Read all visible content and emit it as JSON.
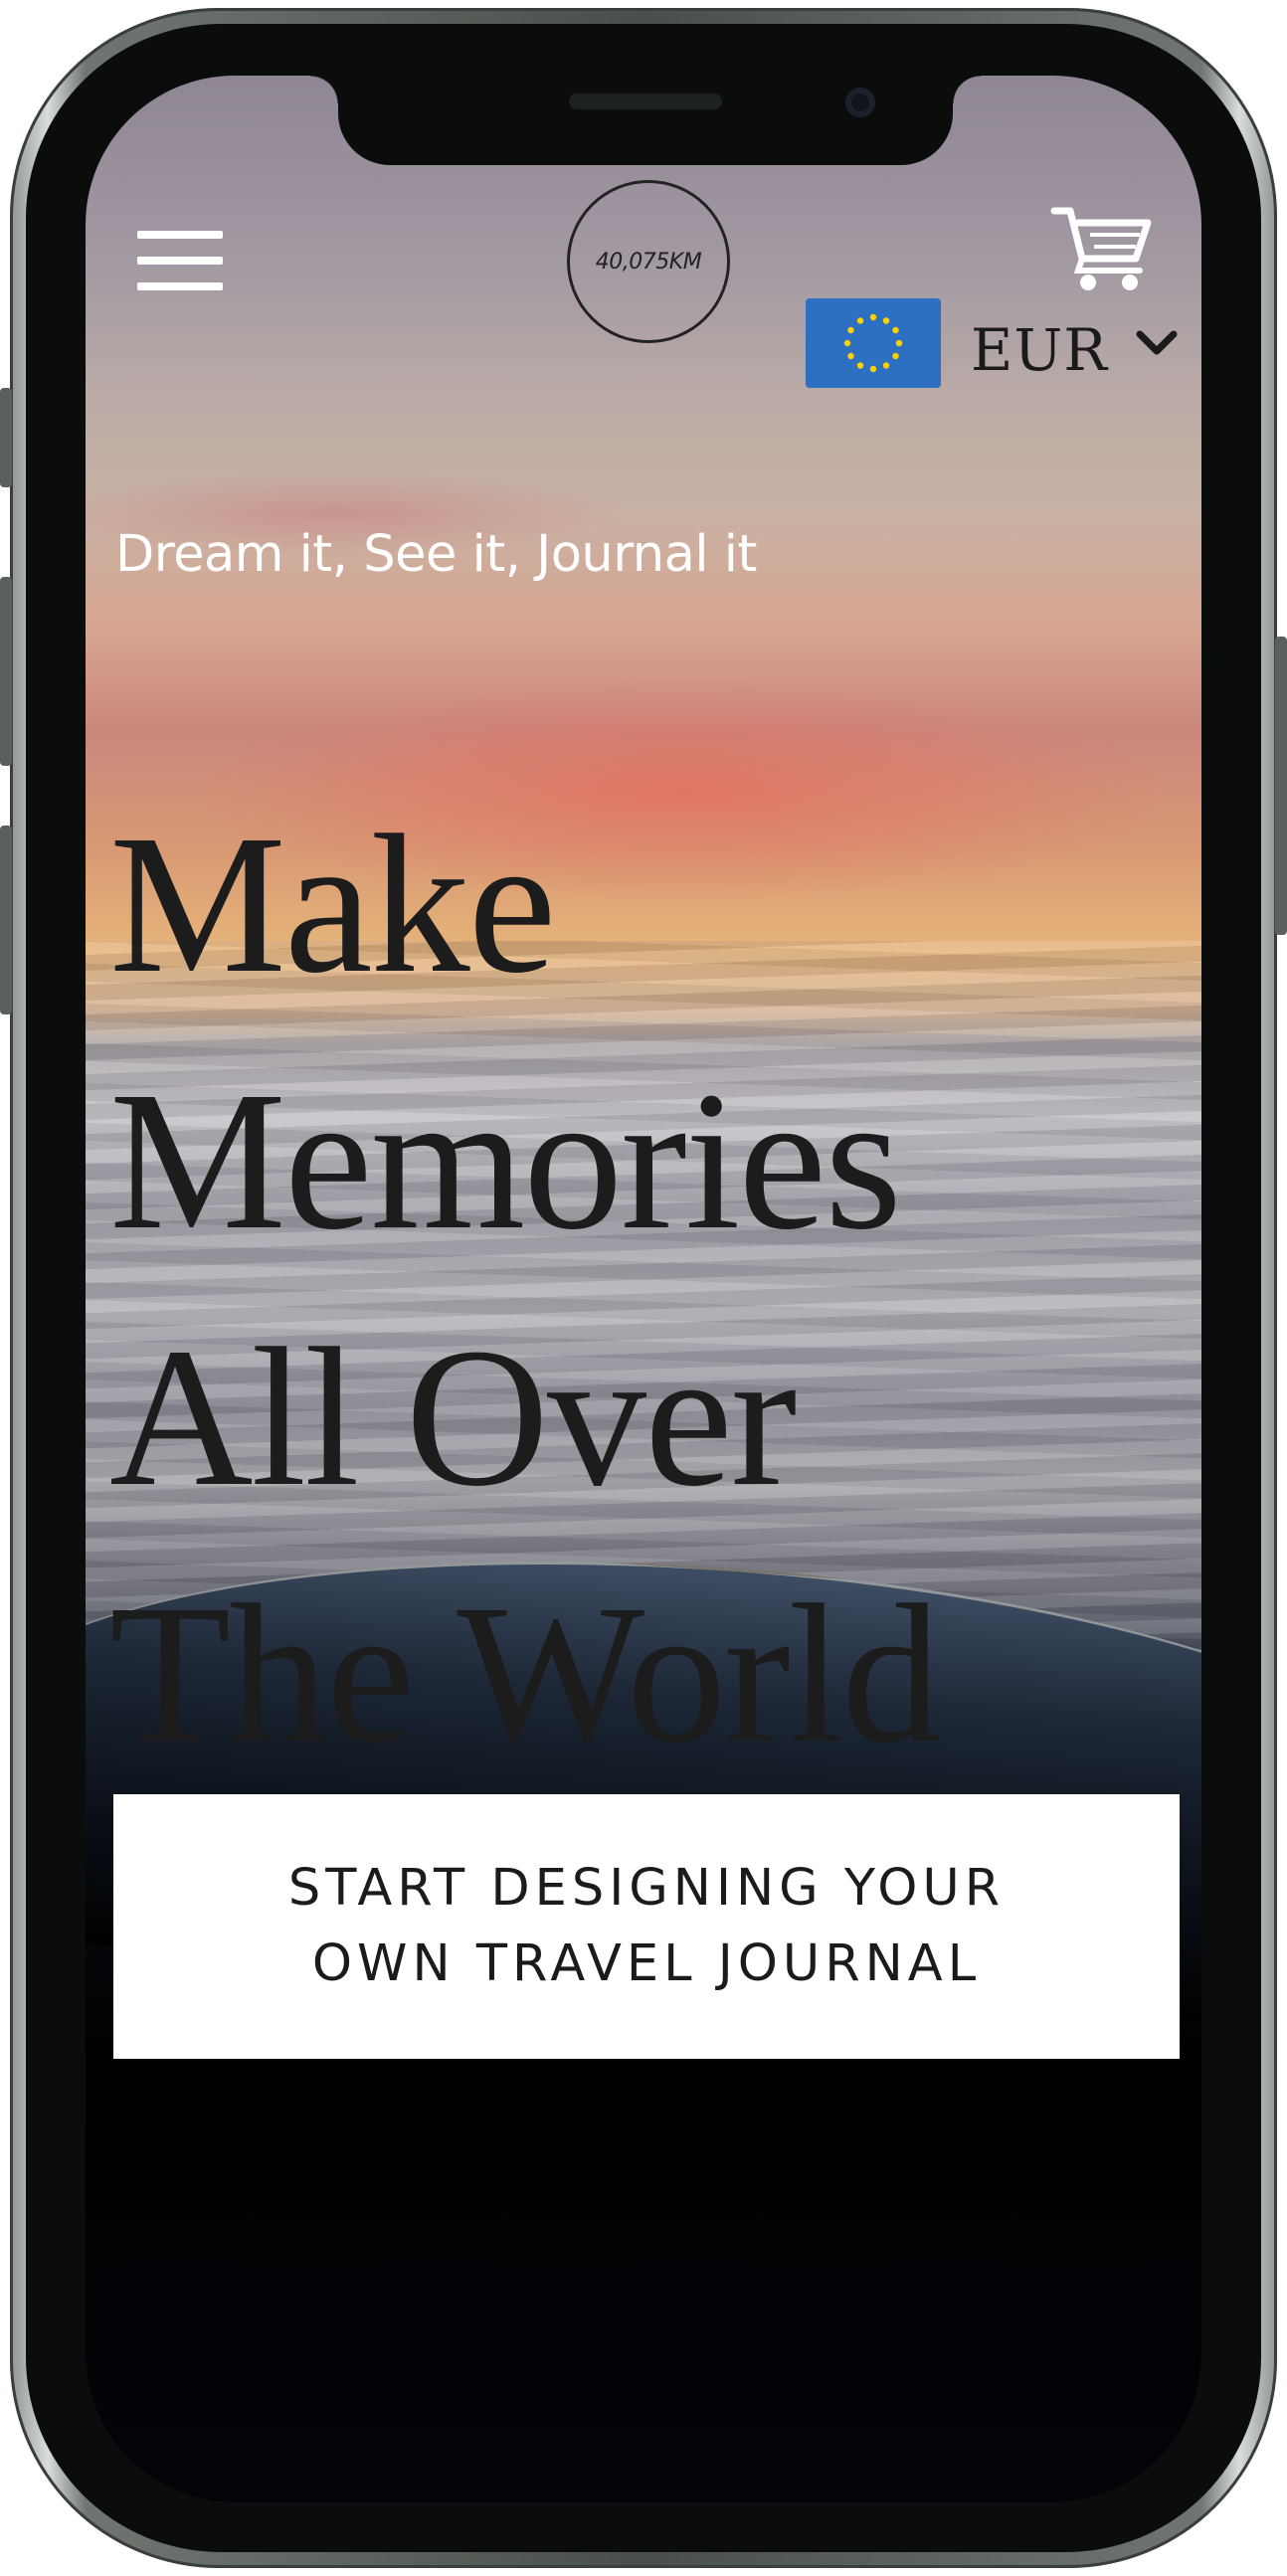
{
  "header": {
    "logo_text": "40,075KM",
    "menu_icon": "hamburger-icon",
    "cart_icon": "shopping-cart-icon",
    "currency": {
      "code": "EUR",
      "flag_icon": "eu-flag-icon",
      "dropdown_icon": "chevron-down-icon"
    }
  },
  "hero": {
    "tagline": "Dream it, See it, Journal it",
    "headline_lines": [
      "Make",
      "Memories",
      "All Over",
      "The World"
    ],
    "cta_lines": [
      "START DESIGNING YOUR",
      "OWN TRAVEL JOURNAL"
    ]
  },
  "colors": {
    "headline": "#1c1c1c",
    "tagline": "#ffffff",
    "flag_blue": "#2d6fc0",
    "flag_stars": "#ffd100",
    "cta_bg": "#ffffff"
  }
}
